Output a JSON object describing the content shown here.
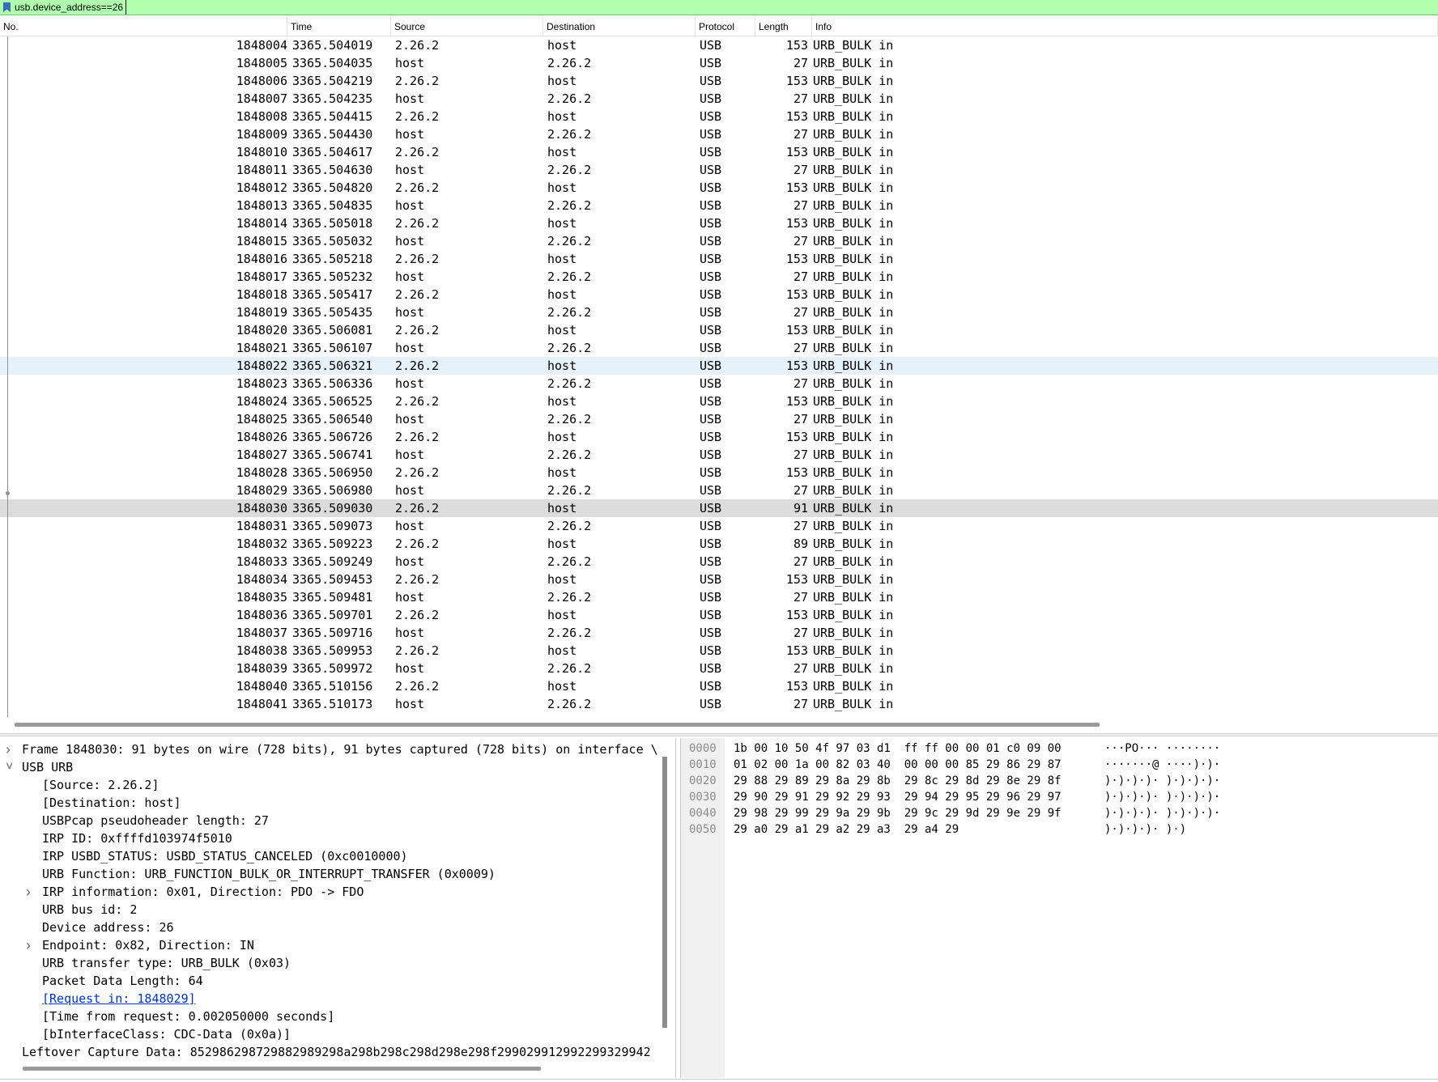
{
  "filter": {
    "value": "usb.device_address==26"
  },
  "columns": [
    "No.",
    "Time",
    "Source",
    "Destination",
    "Protocol",
    "Length",
    "Info"
  ],
  "packets": [
    {
      "no": "1848004",
      "time": "3365.504019",
      "src": "2.26.2",
      "dst": "host",
      "proto": "USB",
      "len": "153",
      "info": "URB_BULK in"
    },
    {
      "no": "1848005",
      "time": "3365.504035",
      "src": "host",
      "dst": "2.26.2",
      "proto": "USB",
      "len": "27",
      "info": "URB_BULK in"
    },
    {
      "no": "1848006",
      "time": "3365.504219",
      "src": "2.26.2",
      "dst": "host",
      "proto": "USB",
      "len": "153",
      "info": "URB_BULK in"
    },
    {
      "no": "1848007",
      "time": "3365.504235",
      "src": "host",
      "dst": "2.26.2",
      "proto": "USB",
      "len": "27",
      "info": "URB_BULK in"
    },
    {
      "no": "1848008",
      "time": "3365.504415",
      "src": "2.26.2",
      "dst": "host",
      "proto": "USB",
      "len": "153",
      "info": "URB_BULK in"
    },
    {
      "no": "1848009",
      "time": "3365.504430",
      "src": "host",
      "dst": "2.26.2",
      "proto": "USB",
      "len": "27",
      "info": "URB_BULK in"
    },
    {
      "no": "1848010",
      "time": "3365.504617",
      "src": "2.26.2",
      "dst": "host",
      "proto": "USB",
      "len": "153",
      "info": "URB_BULK in"
    },
    {
      "no": "1848011",
      "time": "3365.504630",
      "src": "host",
      "dst": "2.26.2",
      "proto": "USB",
      "len": "27",
      "info": "URB_BULK in"
    },
    {
      "no": "1848012",
      "time": "3365.504820",
      "src": "2.26.2",
      "dst": "host",
      "proto": "USB",
      "len": "153",
      "info": "URB_BULK in"
    },
    {
      "no": "1848013",
      "time": "3365.504835",
      "src": "host",
      "dst": "2.26.2",
      "proto": "USB",
      "len": "27",
      "info": "URB_BULK in"
    },
    {
      "no": "1848014",
      "time": "3365.505018",
      "src": "2.26.2",
      "dst": "host",
      "proto": "USB",
      "len": "153",
      "info": "URB_BULK in"
    },
    {
      "no": "1848015",
      "time": "3365.505032",
      "src": "host",
      "dst": "2.26.2",
      "proto": "USB",
      "len": "27",
      "info": "URB_BULK in"
    },
    {
      "no": "1848016",
      "time": "3365.505218",
      "src": "2.26.2",
      "dst": "host",
      "proto": "USB",
      "len": "153",
      "info": "URB_BULK in"
    },
    {
      "no": "1848017",
      "time": "3365.505232",
      "src": "host",
      "dst": "2.26.2",
      "proto": "USB",
      "len": "27",
      "info": "URB_BULK in"
    },
    {
      "no": "1848018",
      "time": "3365.505417",
      "src": "2.26.2",
      "dst": "host",
      "proto": "USB",
      "len": "153",
      "info": "URB_BULK in"
    },
    {
      "no": "1848019",
      "time": "3365.505435",
      "src": "host",
      "dst": "2.26.2",
      "proto": "USB",
      "len": "27",
      "info": "URB_BULK in"
    },
    {
      "no": "1848020",
      "time": "3365.506081",
      "src": "2.26.2",
      "dst": "host",
      "proto": "USB",
      "len": "153",
      "info": "URB_BULK in"
    },
    {
      "no": "1848021",
      "time": "3365.506107",
      "src": "host",
      "dst": "2.26.2",
      "proto": "USB",
      "len": "27",
      "info": "URB_BULK in"
    },
    {
      "no": "1848022",
      "time": "3365.506321",
      "src": "2.26.2",
      "dst": "host",
      "proto": "USB",
      "len": "153",
      "info": "URB_BULK in"
    },
    {
      "no": "1848023",
      "time": "3365.506336",
      "src": "host",
      "dst": "2.26.2",
      "proto": "USB",
      "len": "27",
      "info": "URB_BULK in"
    },
    {
      "no": "1848024",
      "time": "3365.506525",
      "src": "2.26.2",
      "dst": "host",
      "proto": "USB",
      "len": "153",
      "info": "URB_BULK in"
    },
    {
      "no": "1848025",
      "time": "3365.506540",
      "src": "host",
      "dst": "2.26.2",
      "proto": "USB",
      "len": "27",
      "info": "URB_BULK in"
    },
    {
      "no": "1848026",
      "time": "3365.506726",
      "src": "2.26.2",
      "dst": "host",
      "proto": "USB",
      "len": "153",
      "info": "URB_BULK in"
    },
    {
      "no": "1848027",
      "time": "3365.506741",
      "src": "host",
      "dst": "2.26.2",
      "proto": "USB",
      "len": "27",
      "info": "URB_BULK in"
    },
    {
      "no": "1848028",
      "time": "3365.506950",
      "src": "2.26.2",
      "dst": "host",
      "proto": "USB",
      "len": "153",
      "info": "URB_BULK in"
    },
    {
      "no": "1848029",
      "time": "3365.506980",
      "src": "host",
      "dst": "2.26.2",
      "proto": "USB",
      "len": "27",
      "info": "URB_BULK in"
    },
    {
      "no": "1848030",
      "time": "3365.509030",
      "src": "2.26.2",
      "dst": "host",
      "proto": "USB",
      "len": "91",
      "info": "URB_BULK in"
    },
    {
      "no": "1848031",
      "time": "3365.509073",
      "src": "host",
      "dst": "2.26.2",
      "proto": "USB",
      "len": "27",
      "info": "URB_BULK in"
    },
    {
      "no": "1848032",
      "time": "3365.509223",
      "src": "2.26.2",
      "dst": "host",
      "proto": "USB",
      "len": "89",
      "info": "URB_BULK in"
    },
    {
      "no": "1848033",
      "time": "3365.509249",
      "src": "host",
      "dst": "2.26.2",
      "proto": "USB",
      "len": "27",
      "info": "URB_BULK in"
    },
    {
      "no": "1848034",
      "time": "3365.509453",
      "src": "2.26.2",
      "dst": "host",
      "proto": "USB",
      "len": "153",
      "info": "URB_BULK in"
    },
    {
      "no": "1848035",
      "time": "3365.509481",
      "src": "host",
      "dst": "2.26.2",
      "proto": "USB",
      "len": "27",
      "info": "URB_BULK in"
    },
    {
      "no": "1848036",
      "time": "3365.509701",
      "src": "2.26.2",
      "dst": "host",
      "proto": "USB",
      "len": "153",
      "info": "URB_BULK in"
    },
    {
      "no": "1848037",
      "time": "3365.509716",
      "src": "host",
      "dst": "2.26.2",
      "proto": "USB",
      "len": "27",
      "info": "URB_BULK in"
    },
    {
      "no": "1848038",
      "time": "3365.509953",
      "src": "2.26.2",
      "dst": "host",
      "proto": "USB",
      "len": "153",
      "info": "URB_BULK in"
    },
    {
      "no": "1848039",
      "time": "3365.509972",
      "src": "host",
      "dst": "2.26.2",
      "proto": "USB",
      "len": "27",
      "info": "URB_BULK in"
    },
    {
      "no": "1848040",
      "time": "3365.510156",
      "src": "2.26.2",
      "dst": "host",
      "proto": "USB",
      "len": "153",
      "info": "URB_BULK in"
    },
    {
      "no": "1848041",
      "time": "3365.510173",
      "src": "host",
      "dst": "2.26.2",
      "proto": "USB",
      "len": "27",
      "info": "URB_BULK in"
    }
  ],
  "hover_packet_no": "1848022",
  "selected_packet_no": "1848030",
  "details": [
    {
      "text": "Frame 1848030: 91 bytes on wire (728 bits), 91 bytes captured (728 bits) on interface \\",
      "indent": 0,
      "arrow": "collapsed"
    },
    {
      "text": "USB URB",
      "indent": 0,
      "arrow": "expanded"
    },
    {
      "text": "[Source: 2.26.2]",
      "indent": 1,
      "arrow": "none"
    },
    {
      "text": "[Destination: host]",
      "indent": 1,
      "arrow": "none"
    },
    {
      "text": "USBPcap pseudoheader length: 27",
      "indent": 1,
      "arrow": "none"
    },
    {
      "text": "IRP ID: 0xffffd103974f5010",
      "indent": 1,
      "arrow": "none"
    },
    {
      "text": "IRP USBD_STATUS: USBD_STATUS_CANCELED (0xc0010000)",
      "indent": 1,
      "arrow": "none"
    },
    {
      "text": "URB Function: URB_FUNCTION_BULK_OR_INTERRUPT_TRANSFER (0x0009)",
      "indent": 1,
      "arrow": "none"
    },
    {
      "text": "IRP information: 0x01, Direction: PDO -> FDO",
      "indent": 1,
      "arrow": "collapsed"
    },
    {
      "text": "URB bus id: 2",
      "indent": 1,
      "arrow": "none"
    },
    {
      "text": "Device address: 26",
      "indent": 1,
      "arrow": "none"
    },
    {
      "text": "Endpoint: 0x82, Direction: IN",
      "indent": 1,
      "arrow": "collapsed"
    },
    {
      "text": "URB transfer type: URB_BULK (0x03)",
      "indent": 1,
      "arrow": "none"
    },
    {
      "text": "Packet Data Length: 64",
      "indent": 1,
      "arrow": "none"
    },
    {
      "text": "[Request in: 1848029]",
      "indent": 1,
      "arrow": "none",
      "link": true
    },
    {
      "text": "[Time from request: 0.002050000 seconds]",
      "indent": 1,
      "arrow": "none"
    },
    {
      "text": "[bInterfaceClass: CDC-Data (0x0a)]",
      "indent": 1,
      "arrow": "none"
    },
    {
      "text": "Leftover Capture Data: 852986298729882989298a298b298c298d298e298f299029912992299329942",
      "indent": 0,
      "arrow": "none"
    }
  ],
  "bytes": [
    {
      "offset": "0000",
      "hex": "1b 00 10 50 4f 97 03 d1  ff ff 00 00 01 c0 09 00",
      "ascii": "···PO··· ········"
    },
    {
      "offset": "0010",
      "hex": "01 02 00 1a 00 82 03 40  00 00 00 85 29 86 29 87",
      "ascii": "·······@ ····)·)·"
    },
    {
      "offset": "0020",
      "hex": "29 88 29 89 29 8a 29 8b  29 8c 29 8d 29 8e 29 8f",
      "ascii": ")·)·)·)· )·)·)·)·"
    },
    {
      "offset": "0030",
      "hex": "29 90 29 91 29 92 29 93  29 94 29 95 29 96 29 97",
      "ascii": ")·)·)·)· )·)·)·)·"
    },
    {
      "offset": "0040",
      "hex": "29 98 29 99 29 9a 29 9b  29 9c 29 9d 29 9e 29 9f",
      "ascii": ")·)·)·)· )·)·)·)·"
    },
    {
      "offset": "0050",
      "hex": "29 a0 29 a1 29 a2 29 a3  29 a4 29",
      "ascii": ")·)·)·)· )·)"
    }
  ],
  "icons": {
    "bookmark": "bookmark-icon",
    "expand": "chevron-right-icon",
    "collapse": "chevron-down-icon"
  },
  "colors": {
    "filter_valid_bg": "#afffaf",
    "hover_row": "#e6f2fb",
    "selected_row": "#dcdcdc",
    "link": "#0033cc"
  }
}
